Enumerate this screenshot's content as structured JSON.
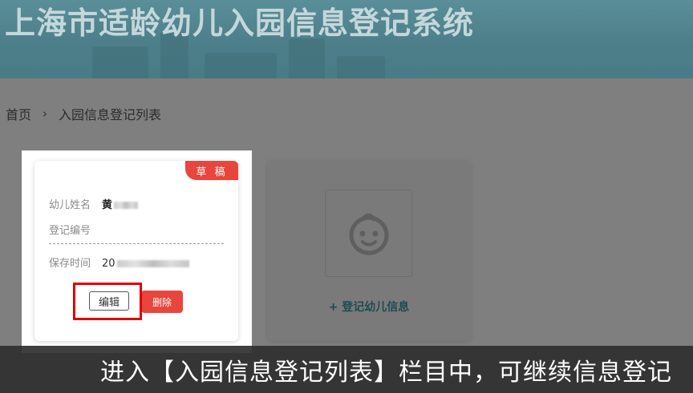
{
  "header": {
    "title": "上海市适龄幼儿入园信息登记系统"
  },
  "breadcrumb": {
    "home": "首页",
    "separator": "›",
    "current": "入园信息登记列表"
  },
  "record_card": {
    "status": "草 稿",
    "name_label": "幼儿姓名",
    "name_value": "黄",
    "reg_no_label": "登记编号",
    "reg_no_value": "",
    "saved_time_label": "保存时间",
    "saved_time_value": "20",
    "edit_button": "编辑",
    "delete_button": "删除"
  },
  "add_card": {
    "icon": "baby-face-icon",
    "label": "+ 登记幼儿信息"
  },
  "caption": {
    "text": "进入【入园信息登记列表】栏目中，可继续信息登记"
  },
  "colors": {
    "header": "#4c7f8a",
    "accent_red": "#e8453c",
    "add_text": "#1f4a55"
  }
}
